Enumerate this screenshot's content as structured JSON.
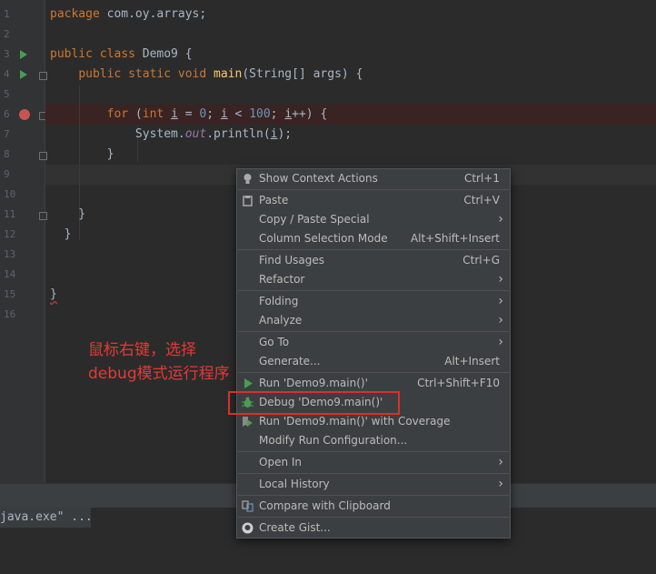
{
  "editor": {
    "lines": [
      {
        "number": "1",
        "text": "package com.oy.arrays;"
      },
      {
        "number": "2",
        "text": ""
      },
      {
        "number": "3",
        "text": "public class Demo9 {"
      },
      {
        "number": "4",
        "text": "    public static void main(String[] args) {"
      },
      {
        "number": "5",
        "text": ""
      },
      {
        "number": "6",
        "text": "        for (int i = 0; i < 100; i++) {"
      },
      {
        "number": "7",
        "text": "            System.out.println(i);"
      },
      {
        "number": "8",
        "text": "        }"
      },
      {
        "number": "9",
        "text": ""
      },
      {
        "number": "10",
        "text": ""
      },
      {
        "number": "11",
        "text": "    }"
      },
      {
        "number": "12",
        "text": "}"
      },
      {
        "number": "13",
        "text": ""
      },
      {
        "number": "14",
        "text": ""
      },
      {
        "number": "15",
        "text": "}"
      },
      {
        "number": "16",
        "text": ""
      }
    ],
    "breakpoint_line": "6",
    "colors": {
      "keyword": "#cc7832",
      "method": "#ffc66d",
      "number": "#6897bb",
      "field": "#9876aa",
      "breakpoint": "#c75450",
      "run": "#499c54"
    }
  },
  "console": {
    "text": "java.exe\" ..."
  },
  "annotation": {
    "line1": "鼠标右键，选择",
    "line2": "debug模式运行程序",
    "color": "#e53935"
  },
  "context_menu": {
    "show_context_actions": {
      "label": "Show Context Actions",
      "shortcut": "Ctrl+1",
      "icon": "lightbulb-icon"
    },
    "paste": {
      "label": "Paste",
      "shortcut": "Ctrl+V",
      "icon": "clipboard-icon"
    },
    "copy_paste_special": {
      "label": "Copy / Paste Special"
    },
    "column_selection_mode": {
      "label": "Column Selection Mode",
      "shortcut": "Alt+Shift+Insert"
    },
    "find_usages": {
      "label": "Find Usages",
      "shortcut": "Ctrl+G"
    },
    "refactor": {
      "label": "Refactor"
    },
    "folding": {
      "label": "Folding"
    },
    "analyze": {
      "label": "Analyze"
    },
    "go_to": {
      "label": "Go To"
    },
    "generate": {
      "label": "Generate...",
      "shortcut": "Alt+Insert"
    },
    "run": {
      "label": "Run 'Demo9.main()'",
      "shortcut": "Ctrl+Shift+F10",
      "icon": "run-icon"
    },
    "debug": {
      "label": "Debug 'Demo9.main()'",
      "icon": "debug-bug-icon"
    },
    "run_coverage": {
      "label": "Run 'Demo9.main()' with Coverage",
      "icon": "coverage-icon"
    },
    "modify_run_config": {
      "label": "Modify Run Configuration..."
    },
    "open_in": {
      "label": "Open In"
    },
    "local_history": {
      "label": "Local History"
    },
    "compare_clipboard": {
      "label": "Compare with Clipboard",
      "icon": "compare-icon"
    },
    "create_gist": {
      "label": "Create Gist...",
      "icon": "github-icon"
    }
  }
}
